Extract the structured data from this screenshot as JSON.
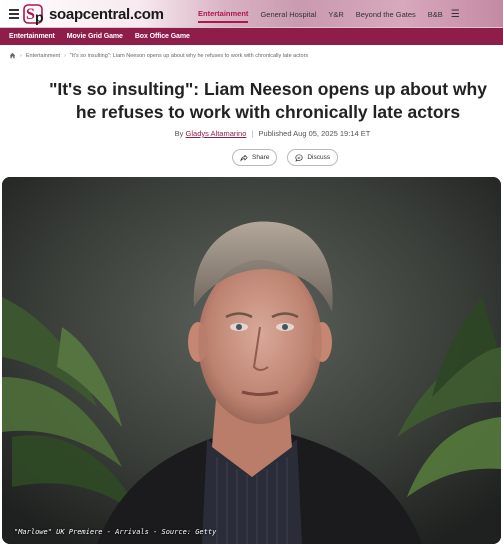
{
  "header": {
    "logo_text": "soapcentral.com",
    "nav": [
      {
        "label": "Entertainment",
        "active": true
      },
      {
        "label": "General Hospital",
        "active": false
      },
      {
        "label": "Y&R",
        "active": false
      },
      {
        "label": "Beyond the Gates",
        "active": false
      },
      {
        "label": "B&B",
        "active": false
      }
    ],
    "more_icon": "☰"
  },
  "subnav": [
    "Entertainment",
    "Movie Grid Game",
    "Box Office Game"
  ],
  "breadcrumb": {
    "items": [
      "Entertainment",
      "\"It's so insulting\": Liam Neeson opens up about why he refuses to work with chronically late actors"
    ]
  },
  "article": {
    "headline": "\"It's so insulting\": Liam Neeson opens up about why he refuses to work with chronically late actors",
    "by_prefix": "By",
    "author": "Gladys Altamarino",
    "published": "Published Aug 05, 2025 19:14 ET",
    "share_label": "Share",
    "discuss_label": "Discuss",
    "caption": "\"Marlowe\" UK Premiere - Arrivals - Source: Getty"
  },
  "colors": {
    "brand": "#8e1d4a",
    "active_nav": "#b0154f"
  }
}
